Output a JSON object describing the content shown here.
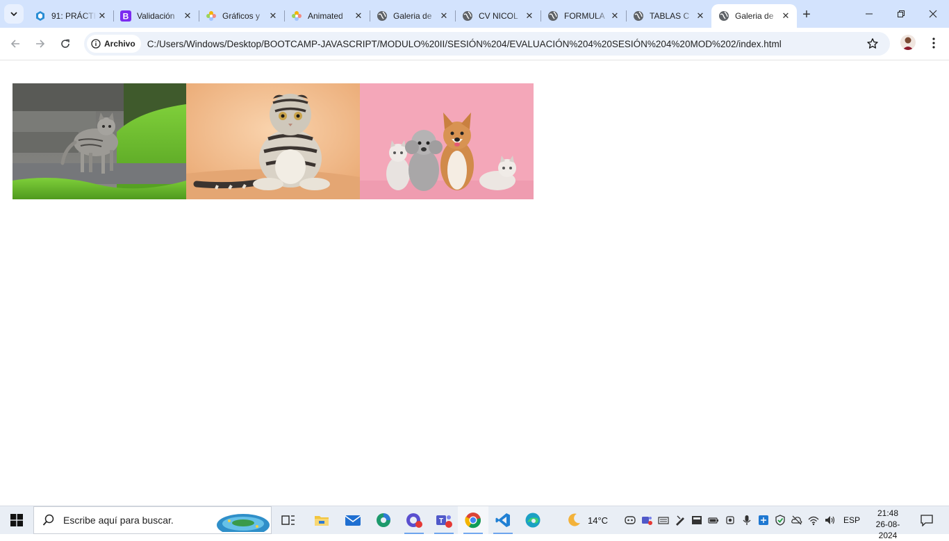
{
  "browser": {
    "tabs": [
      {
        "title": "91: PRÁCTICA",
        "favicon": "codepen-cube-icon"
      },
      {
        "title": "Validación",
        "favicon": "bootstrap-icon"
      },
      {
        "title": "Gráficos y",
        "favicon": "flower-icon"
      },
      {
        "title": "Animated",
        "favicon": "flower-icon"
      },
      {
        "title": "Galeria de",
        "favicon": "globe-icon"
      },
      {
        "title": "CV NICOL",
        "favicon": "globe-icon"
      },
      {
        "title": "FORMULA",
        "favicon": "globe-icon"
      },
      {
        "title": "TABLAS C",
        "favicon": "globe-icon"
      },
      {
        "title": "Galeria de",
        "favicon": "globe-icon",
        "active": true
      }
    ],
    "omnibox": {
      "chip_label": "Archivo",
      "url": "C:/Users/Windows/Desktop/BOOTCAMP-JAVASCRIPT/MODULO%20II/SESIÓN%204/EVALUACIÓN%204%20SESIÓN%204%20MOD%202/index.html"
    }
  },
  "page": {
    "photos": [
      {
        "subject": "tabby kitten walking on grass by steps"
      },
      {
        "subject": "scottish fold tabby cat sitting"
      },
      {
        "subject": "cats and dogs sitting on pink background"
      }
    ]
  },
  "taskbar": {
    "search_placeholder": "Escribe aquí para buscar.",
    "weather": "14°C",
    "language": "ESP",
    "time": "21:48",
    "date": "26-08-2024"
  },
  "colors": {
    "tabstrip_bg": "#d3e3fd",
    "omnibox_bg": "#edf2fa",
    "taskbar_bg": "#e9eef5",
    "accent": "#1a73e8"
  }
}
